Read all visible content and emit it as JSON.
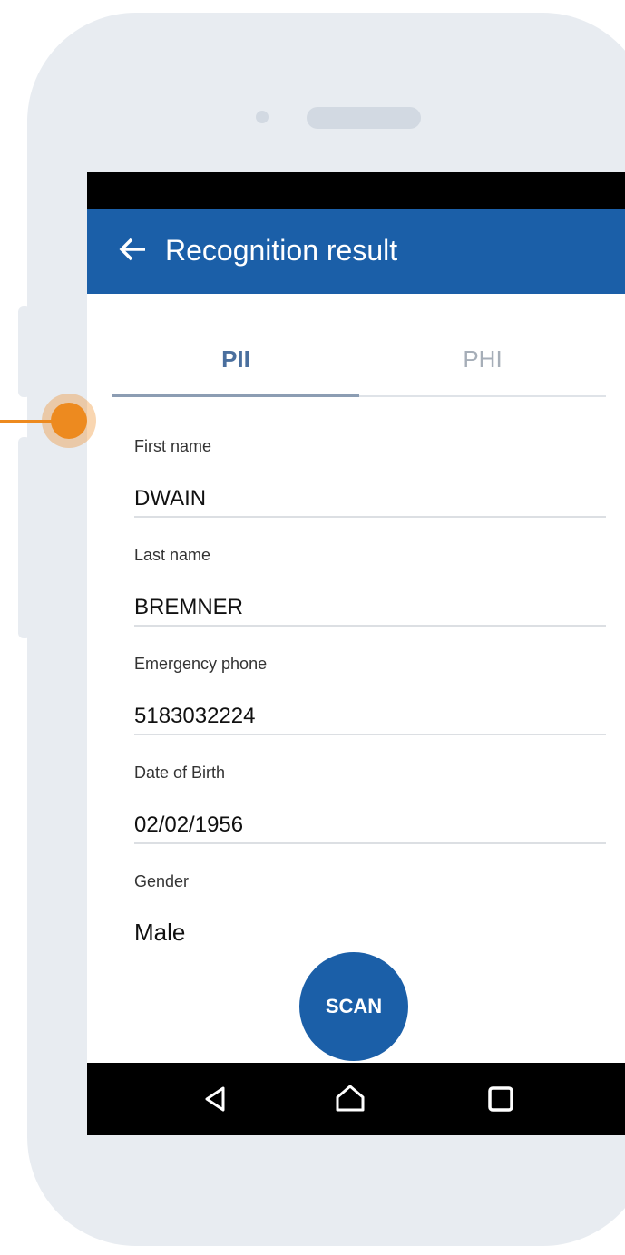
{
  "colors": {
    "app_bar": "#1b5fa8",
    "tab_active": "#4a6f9e",
    "tab_inactive": "#a6aeb8",
    "pointer": "#ed8a1f",
    "phone_frame": "#e8ecf1"
  },
  "app_bar": {
    "back_icon": "arrow-left-icon",
    "title": "Recognition result"
  },
  "tabs": [
    {
      "label": "PII",
      "selected": true
    },
    {
      "label": "PHI",
      "selected": false
    }
  ],
  "fields": [
    {
      "label": "First name",
      "value": "DWAIN"
    },
    {
      "label": "Last name",
      "value": "BREMNER"
    },
    {
      "label": "Emergency phone",
      "value": "5183032224"
    },
    {
      "label": "Date of Birth",
      "value": "02/02/1956"
    },
    {
      "label": "Gender",
      "value": "Male"
    }
  ],
  "fab": {
    "label": "SCAN"
  },
  "nav_bar": {
    "icons": [
      "triangle-back-icon",
      "home-icon",
      "recent-apps-icon"
    ]
  }
}
